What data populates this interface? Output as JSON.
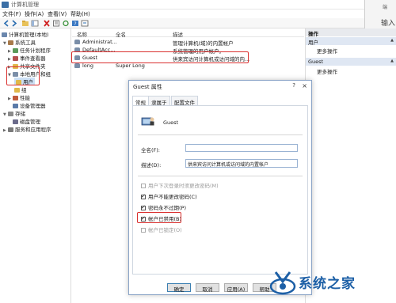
{
  "window": {
    "title": "计算机管理"
  },
  "menu": {
    "items": [
      "文件(F)",
      "操作(A)",
      "查看(V)",
      "帮助(H)"
    ]
  },
  "tree": {
    "items": [
      {
        "label": "计算机管理(本地)",
        "indent": 0
      },
      {
        "label": "系统工具",
        "indent": 1
      },
      {
        "label": "任务计划程序",
        "indent": 2
      },
      {
        "label": "事件查看器",
        "indent": 2
      },
      {
        "label": "共享文件夹",
        "indent": 2
      },
      {
        "label": "本地用户和组",
        "indent": 2
      },
      {
        "label": "用户",
        "indent": 3
      },
      {
        "label": "组",
        "indent": 3
      },
      {
        "label": "性能",
        "indent": 2
      },
      {
        "label": "设备管理器",
        "indent": 2
      },
      {
        "label": "存储",
        "indent": 1
      },
      {
        "label": "磁盘管理",
        "indent": 2
      },
      {
        "label": "服务和应用程序",
        "indent": 1
      }
    ]
  },
  "list": {
    "columns": [
      "名称",
      "全名",
      "描述"
    ],
    "rows": [
      {
        "name": "Administrat...",
        "fullname": "",
        "desc": "管理计算机(域)的内置帐户"
      },
      {
        "name": "DefaultAcc...",
        "fullname": "",
        "desc": "系统管理的用户帐户。"
      },
      {
        "name": "Guest",
        "fullname": "",
        "desc": "供来宾访问计算机或访问域的内..."
      },
      {
        "name": "long",
        "fullname": "Super Long",
        "desc": ""
      }
    ]
  },
  "actions": {
    "header": "操作",
    "group1": "用户",
    "more1": "更多操作",
    "group2": "Guest",
    "more2": "更多操作"
  },
  "ghost": {
    "text1": "端",
    "text2": "输入"
  },
  "dialog": {
    "title": "Guest 属性",
    "help": "?",
    "close": "×",
    "tabs": [
      "常规",
      "隶属于",
      "配置文件"
    ],
    "username": "Guest",
    "fullname_label": "全名(F):",
    "fullname_value": "",
    "desc_label": "描述(D):",
    "desc_value": "供来宾访问计算机或访问域的内置帐户",
    "checkboxes": [
      {
        "label": "用户下次登录时须更改密码(M)",
        "checked": false,
        "disabled": true
      },
      {
        "label": "用户不能更改密码(C)",
        "checked": true,
        "disabled": false
      },
      {
        "label": "密码永不过期(P)",
        "checked": true,
        "disabled": false
      },
      {
        "label": "帐户已禁用(B)",
        "checked": true,
        "disabled": false
      },
      {
        "label": "帐户已锁定(O)",
        "checked": false,
        "disabled": true
      }
    ],
    "buttons": {
      "ok": "确定",
      "cancel": "取消",
      "apply": "应用(A)",
      "help": "帮助"
    }
  },
  "watermark": {
    "text": "系统之家"
  },
  "colors": {
    "highlight": "#d9302f",
    "accent": "#1c5fa6"
  }
}
